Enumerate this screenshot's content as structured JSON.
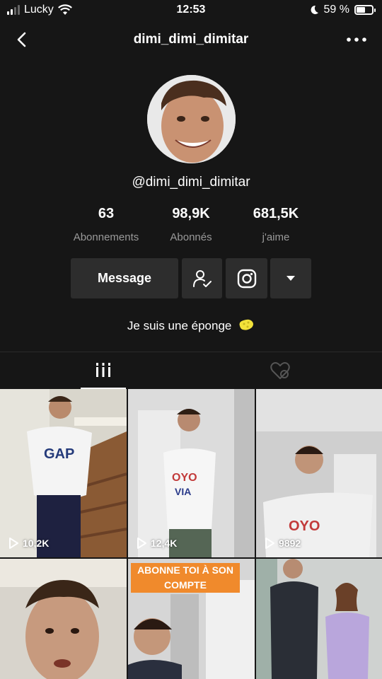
{
  "status_bar": {
    "carrier": "Lucky",
    "time": "12:53",
    "battery": "59 %",
    "battery_level": 0.59
  },
  "header": {
    "title": "dimi_dimi_dimitar"
  },
  "profile": {
    "handle": "@dimi_dimi_dimitar",
    "bio": "Je suis une éponge",
    "stats": [
      {
        "value": "63",
        "label": "Abonnements"
      },
      {
        "value": "98,9K",
        "label": "Abonnés"
      },
      {
        "value": "681,5K",
        "label": "j'aime"
      }
    ]
  },
  "actions": {
    "message_label": "Message"
  },
  "videos": [
    {
      "views": "10,2K",
      "scene": "stairs"
    },
    {
      "views": "12,4K",
      "scene": "door"
    },
    {
      "views": "9892",
      "scene": "room"
    },
    {
      "views": "",
      "scene": "closeup"
    },
    {
      "views": "",
      "scene": "banner",
      "banner_line1": "ABONNE TOI À SON",
      "banner_line2": "COMPTE"
    },
    {
      "views": "",
      "scene": "duo"
    }
  ]
}
